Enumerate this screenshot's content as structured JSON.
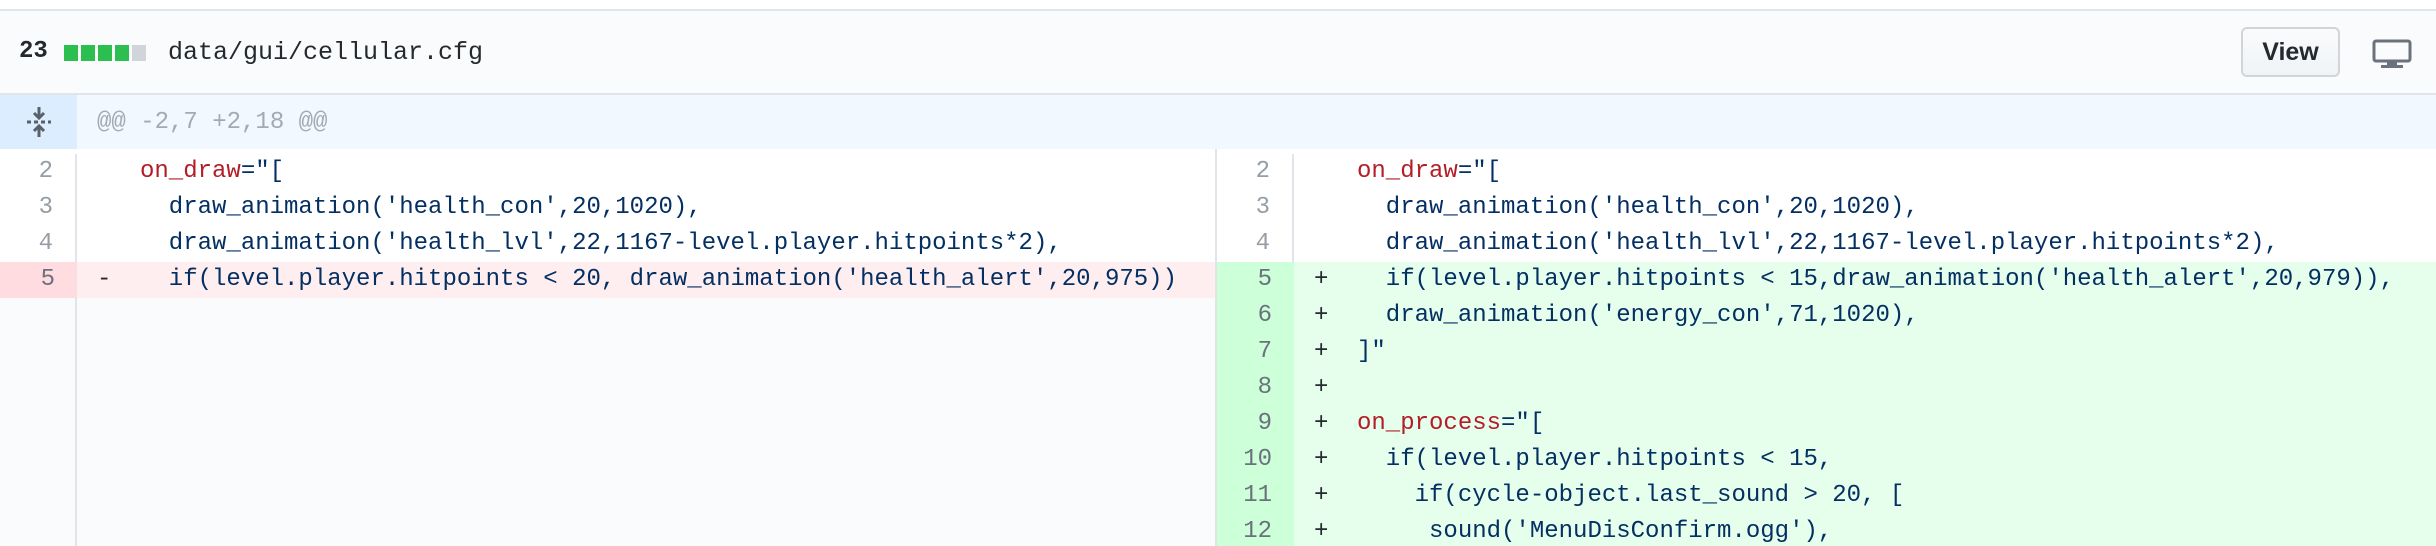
{
  "file": {
    "changes": "23",
    "path": "data/gui/cellular.cfg",
    "stat_blocks": [
      {
        "color": "#2cbe4e"
      },
      {
        "color": "#2cbe4e"
      },
      {
        "color": "#2cbe4e"
      },
      {
        "color": "#2cbe4e"
      },
      {
        "color": "#d1d5da"
      }
    ],
    "view_label": "View",
    "display_icon": "desktop-icon"
  },
  "hunk": {
    "header": "@@ -2,7 +2,18 @@",
    "expand_icon": "unfold-icon"
  },
  "colors": {
    "deletion_bg": "#ffeef0",
    "deletion_gutter": "#ffdce0",
    "addition_bg": "#e6ffed",
    "addition_gutter": "#cdffd8",
    "hunk_bg": "#f1f8ff"
  },
  "left_lines": [
    {
      "num": "2",
      "marker": "",
      "type": "ctx",
      "key": "on_draw",
      "rest": "=\"["
    },
    {
      "num": "3",
      "marker": "",
      "type": "ctx",
      "key": "",
      "rest": "  draw_animation('health_con',20,1020),"
    },
    {
      "num": "4",
      "marker": "",
      "type": "ctx",
      "key": "",
      "rest": "  draw_animation('health_lvl',22,1167-level.player.hitpoints*2),"
    },
    {
      "num": "5",
      "marker": "-",
      "type": "del",
      "key": "",
      "rest": "  if(level.player.hitpoints < 20, draw_animation('health_alert',20,975))"
    }
  ],
  "right_lines": [
    {
      "num": "2",
      "marker": "",
      "type": "ctx",
      "key": "on_draw",
      "rest": "=\"["
    },
    {
      "num": "3",
      "marker": "",
      "type": "ctx",
      "key": "",
      "rest": "  draw_animation('health_con',20,1020),"
    },
    {
      "num": "4",
      "marker": "",
      "type": "ctx",
      "key": "",
      "rest": "  draw_animation('health_lvl',22,1167-level.player.hitpoints*2),"
    },
    {
      "num": "5",
      "marker": "+",
      "type": "add",
      "key": "",
      "rest": "  if(level.player.hitpoints < 15,draw_animation('health_alert',20,979)),"
    },
    {
      "num": "6",
      "marker": "+",
      "type": "add",
      "key": "",
      "rest": "  draw_animation('energy_con',71,1020),"
    },
    {
      "num": "7",
      "marker": "+",
      "type": "add",
      "key": "",
      "rest": "]\""
    },
    {
      "num": "8",
      "marker": "+",
      "type": "add",
      "key": "",
      "rest": ""
    },
    {
      "num": "9",
      "marker": "+",
      "type": "add",
      "key": "on_process",
      "rest": "=\"["
    },
    {
      "num": "10",
      "marker": "+",
      "type": "add",
      "key": "",
      "rest": "  if(level.player.hitpoints < 15,"
    },
    {
      "num": "11",
      "marker": "+",
      "type": "add",
      "key": "",
      "rest": "    if(cycle-object.last_sound > 20, ["
    },
    {
      "num": "12",
      "marker": "+",
      "type": "add",
      "key": "",
      "rest": "     sound('MenuDisConfirm.ogg'),"
    }
  ]
}
